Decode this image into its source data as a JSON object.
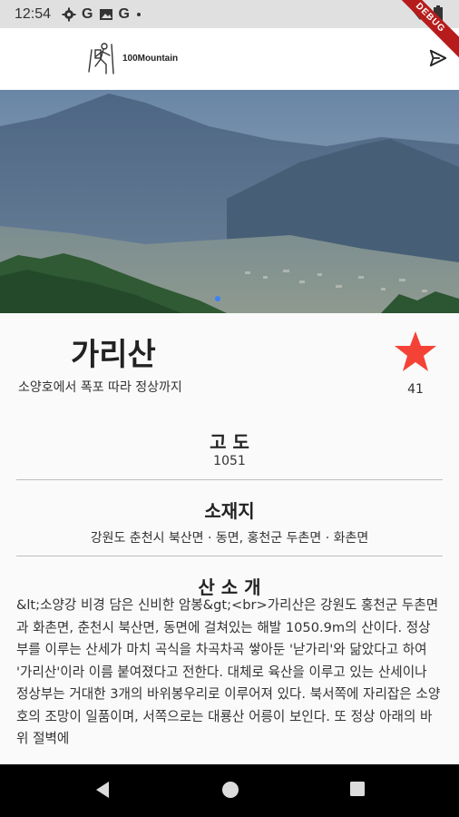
{
  "status_bar": {
    "time": "12:54",
    "icons": [
      "gear-icon",
      "G",
      "gallery-icon",
      "G",
      "dot"
    ],
    "debug_label": "DEBUG"
  },
  "app_bar": {
    "title": "100Mountain"
  },
  "mountain": {
    "name": "가리산",
    "subtitle": "소양호에서 폭포 따라 정상까지",
    "star_count": "41",
    "star_color": "#f44336"
  },
  "sections": {
    "altitude": {
      "title": "고 도",
      "value": "1051"
    },
    "location": {
      "title": "소재지",
      "value": "강원도 춘천시 북산면 · 동면, 홍천군 두촌면 · 화촌면"
    },
    "intro": {
      "title": "산 소 개",
      "text": "&lt;소양강 비경 담은 신비한 암봉&gt;<br>가리산은 강원도 홍천군 두촌면과 화촌면, 춘천시 북산면, 동면에 걸쳐있는 해발 1050.9m의 산이다. 정상부를 이루는 산세가 마치 곡식을 차곡차곡 쌓아둔 '낟가리'와 닮았다고 하여 '가리산'이라 이름 붙여졌다고 전한다. 대체로 육산을 이루고 있는 산세이나 정상부는 거대한 3개의 바위봉우리로 이루어져 있다. 북서쪽에 자리잡은 소양호의 조망이 일품이며, 서쪽으로는 대룡산 어릉이 보인다. 또 정상 아래의 바위 절벽에"
    }
  }
}
